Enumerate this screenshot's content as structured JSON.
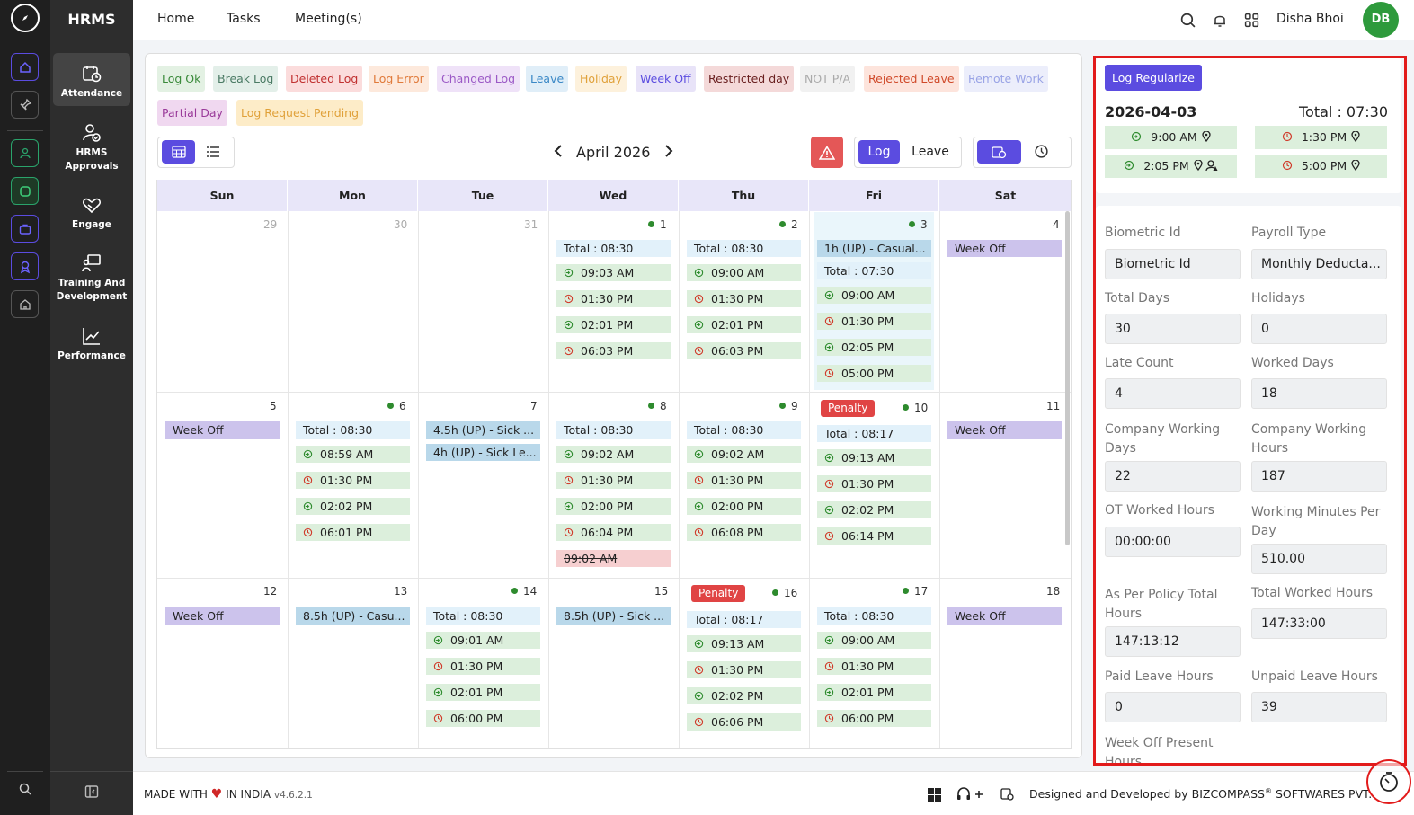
{
  "app": {
    "title": "HRMS"
  },
  "nav": [
    "Attendance",
    "HRMS Approvals",
    "Engage",
    "Training And Development",
    "Performance"
  ],
  "topbar": {
    "links": [
      "Home",
      "Tasks",
      "Meeting(s)"
    ],
    "user": "Disha Bhoi",
    "initials": "DB"
  },
  "legend": [
    "Log Ok",
    "Break Log",
    "Deleted Log",
    "Log Error",
    "Changed Log",
    "Leave",
    "Holiday",
    "Week Off",
    "Restricted day",
    "NOT P/A",
    "Rejected Leave",
    "Remote Work",
    "Partial Day",
    "Log Request Pending"
  ],
  "calendar": {
    "month": "April 2026",
    "toggle": [
      "Log",
      "Leave"
    ],
    "weekdays": [
      "Sun",
      "Mon",
      "Tue",
      "Wed",
      "Thu",
      "Fri",
      "Sat"
    ]
  },
  "days": {
    "d29": "29",
    "d30": "30",
    "d31": "31",
    "d1": "1",
    "d2": "2",
    "d3": "3",
    "d4": "4",
    "d5": "5",
    "d6": "6",
    "d7": "7",
    "d8": "8",
    "d9": "9",
    "d10": "10",
    "d11": "11",
    "d12": "12",
    "d13": "13",
    "d14": "14",
    "d15": "15",
    "d16": "16",
    "d17": "17",
    "d18": "18"
  },
  "cells": {
    "wo": "Week Off",
    "penalty": "Penalty",
    "t0830": "Total : 08:30",
    "t0730": "Total : 07:30",
    "t0817": "Total : 08:17",
    "p0903": "09:03 AM",
    "p0130": "01:30 PM",
    "p0201": "02:01 PM",
    "p0603": "06:03 PM",
    "p0900": "09:00 AM",
    "p0205": "02:05 PM",
    "p0500": "05:00 PM",
    "p0859": "08:59 AM",
    "p0202": "02:02 PM",
    "p0601": "06:01 PM",
    "p0902": "09:02 AM",
    "p0200": "02:00 PM",
    "p0604": "06:04 PM",
    "s0902": "09:02 AM",
    "p0608": "06:08 PM",
    "p0913": "09:13 AM",
    "p0614": "06:14 PM",
    "p0901": "09:01 AM",
    "p0600": "06:00 PM",
    "p0606": "06:06 PM",
    "l1": "1h (UP) - Casual...",
    "l7a": "4.5h (UP) - Sick ...",
    "l7b": "4h (UP) - Sick Le...",
    "l13": "8.5h (UP) - Casu...",
    "l15": "8.5h (UP) - Sick ..."
  },
  "detail": {
    "button": "Log Regularize",
    "date": "2026-04-03",
    "total": "Total : 07:30",
    "punches": [
      "9:00 AM",
      "1:30 PM",
      "2:05 PM",
      "5:00 PM"
    ],
    "fields": [
      {
        "label": "Biometric Id",
        "value": "Biometric Id"
      },
      {
        "label": "Payroll Type",
        "value": "Monthly Deducta..."
      },
      {
        "label": "Total Days",
        "value": "30"
      },
      {
        "label": "Holidays",
        "value": "0"
      },
      {
        "label": "Late Count",
        "value": "4"
      },
      {
        "label": "Worked Days",
        "value": "18"
      },
      {
        "label": "Company Working Days",
        "value": "22"
      },
      {
        "label": "Company Working Hours",
        "value": "187"
      },
      {
        "label": "OT Worked Hours",
        "value": "00:00:00"
      },
      {
        "label": "Working Minutes Per Day",
        "value": "510.00"
      },
      {
        "label": "As Per Policy Total Hours",
        "value": "147:13:12"
      },
      {
        "label": "Total Worked Hours",
        "value": "147:33:00"
      },
      {
        "label": "Paid Leave Hours",
        "value": "0"
      },
      {
        "label": "Unpaid Leave Hours",
        "value": "39"
      },
      {
        "label": "Week Off Present Hours",
        "value": ""
      }
    ]
  },
  "footer": {
    "made": "MADE WITH",
    "in_india": "IN INDIA",
    "version": "v4.6.2.1",
    "designed": "Designed and Developed by",
    "company": "BIZCOMPASS",
    "suffix": "SOFTWARES PVT."
  },
  "colors": {
    "accent": "#5b4ce0",
    "sidebar": "#2d2d2d",
    "penalty": "#e04444",
    "highlight": "#e21b1b"
  }
}
